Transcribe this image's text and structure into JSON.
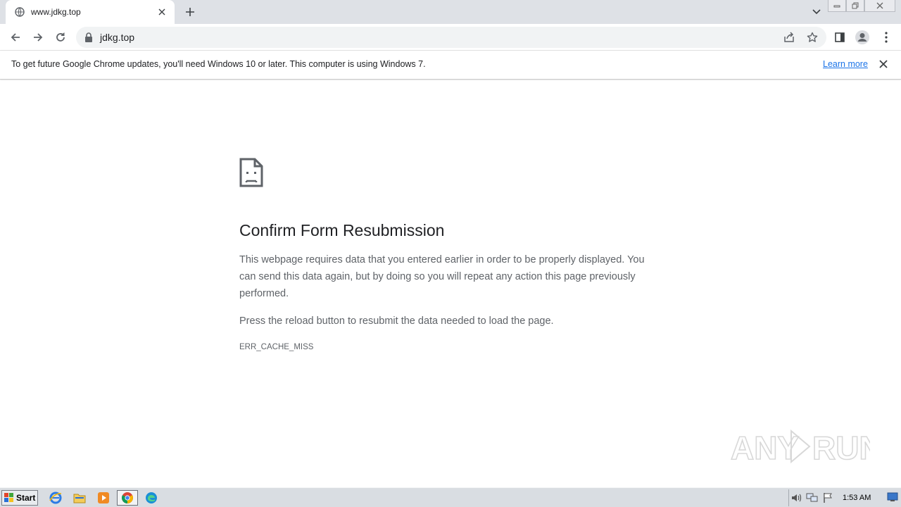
{
  "browser": {
    "tab": {
      "title": "www.jdkg.top",
      "icon": "globe-icon"
    },
    "address": {
      "url": "jdkg.top",
      "icon": "lock-icon"
    },
    "window_buttons": {
      "minimize": "minimize-icon",
      "restore": "restore-icon",
      "close": "close-icon"
    }
  },
  "infobar": {
    "message": "To get future Google Chrome updates, you'll need Windows 10 or later. This computer is using Windows 7.",
    "link": "Learn more"
  },
  "error_page": {
    "icon": "sad-page-icon",
    "title": "Confirm Form Resubmission",
    "paragraph1": "This webpage requires data that you entered earlier in order to be properly displayed. You can send this data again, but by doing so you will repeat any action this page previously performed.",
    "paragraph2": "Press the reload button to resubmit the data needed to load the page.",
    "error_code": "ERR_CACHE_MISS"
  },
  "watermark": {
    "text": "ANY RUN"
  },
  "taskbar": {
    "start_label": "Start",
    "clock": "1:53 AM",
    "pinned": [
      "ie-icon",
      "explorer-icon",
      "media-player-icon",
      "chrome-icon",
      "edge-icon"
    ],
    "tray": [
      "volume-icon",
      "network-icon",
      "flag-icon"
    ]
  },
  "colors": {
    "link": "#1a73e8",
    "tabstrip": "#dee1e6",
    "omnibox": "#f1f3f4",
    "body_text": "#5f6368",
    "heading": "#202124"
  }
}
